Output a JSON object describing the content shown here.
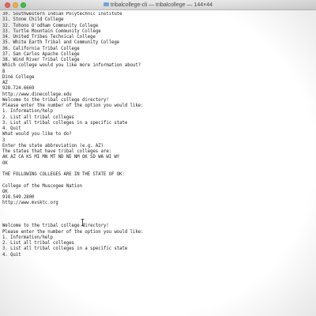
{
  "window": {
    "title": "tribalcollege-cli — tribalcollege — 144×44"
  },
  "terminal": {
    "lines": [
      "30. Southwestern Indian Polytechnic Institute",
      "31. Stone Child College",
      "32. Tohono O'odham Community College",
      "33. Turtle Mountain Community College",
      "34. United Tribes Technical College",
      "35. White Earth Tribal and Community College",
      "36. California Tribal College",
      "37. San Carlos Apache College",
      "38. Wind River Tribal College",
      "Which college would you like more information about?",
      "8",
      "Diné College",
      "AZ",
      "928.724.6669",
      "http://www.dinecollege.edu",
      "Welcome to the tribal college directory!",
      "Please enter the number of the option you would like:",
      "1. Information/help",
      "2. List all tribal colleges",
      "3. List all tribal colleges in a specific state",
      "4. Quit",
      "What would you like to do?",
      "3",
      "Enter the state abbreviation (e.g. AZ)",
      "The states that have tribal colleges are:",
      "AK AZ CA KS MI MN MT ND NE NM OK SD WA WI WY",
      "OK",
      "",
      "THE FOLLOWING COLLEGES ARE IN THE STATE OF OK:",
      "",
      "College of the Muscogee Nation",
      "OK",
      "918.549.2800",
      "http://www.mvsktc.org",
      "",
      "",
      "",
      "Welcome to the tribal college directory!",
      "Please enter the number of the option you would like:",
      "1. Information/help",
      "2. List all tribal colleges",
      "3. List all tribal colleges in a specific state",
      "4. Quit"
    ]
  }
}
